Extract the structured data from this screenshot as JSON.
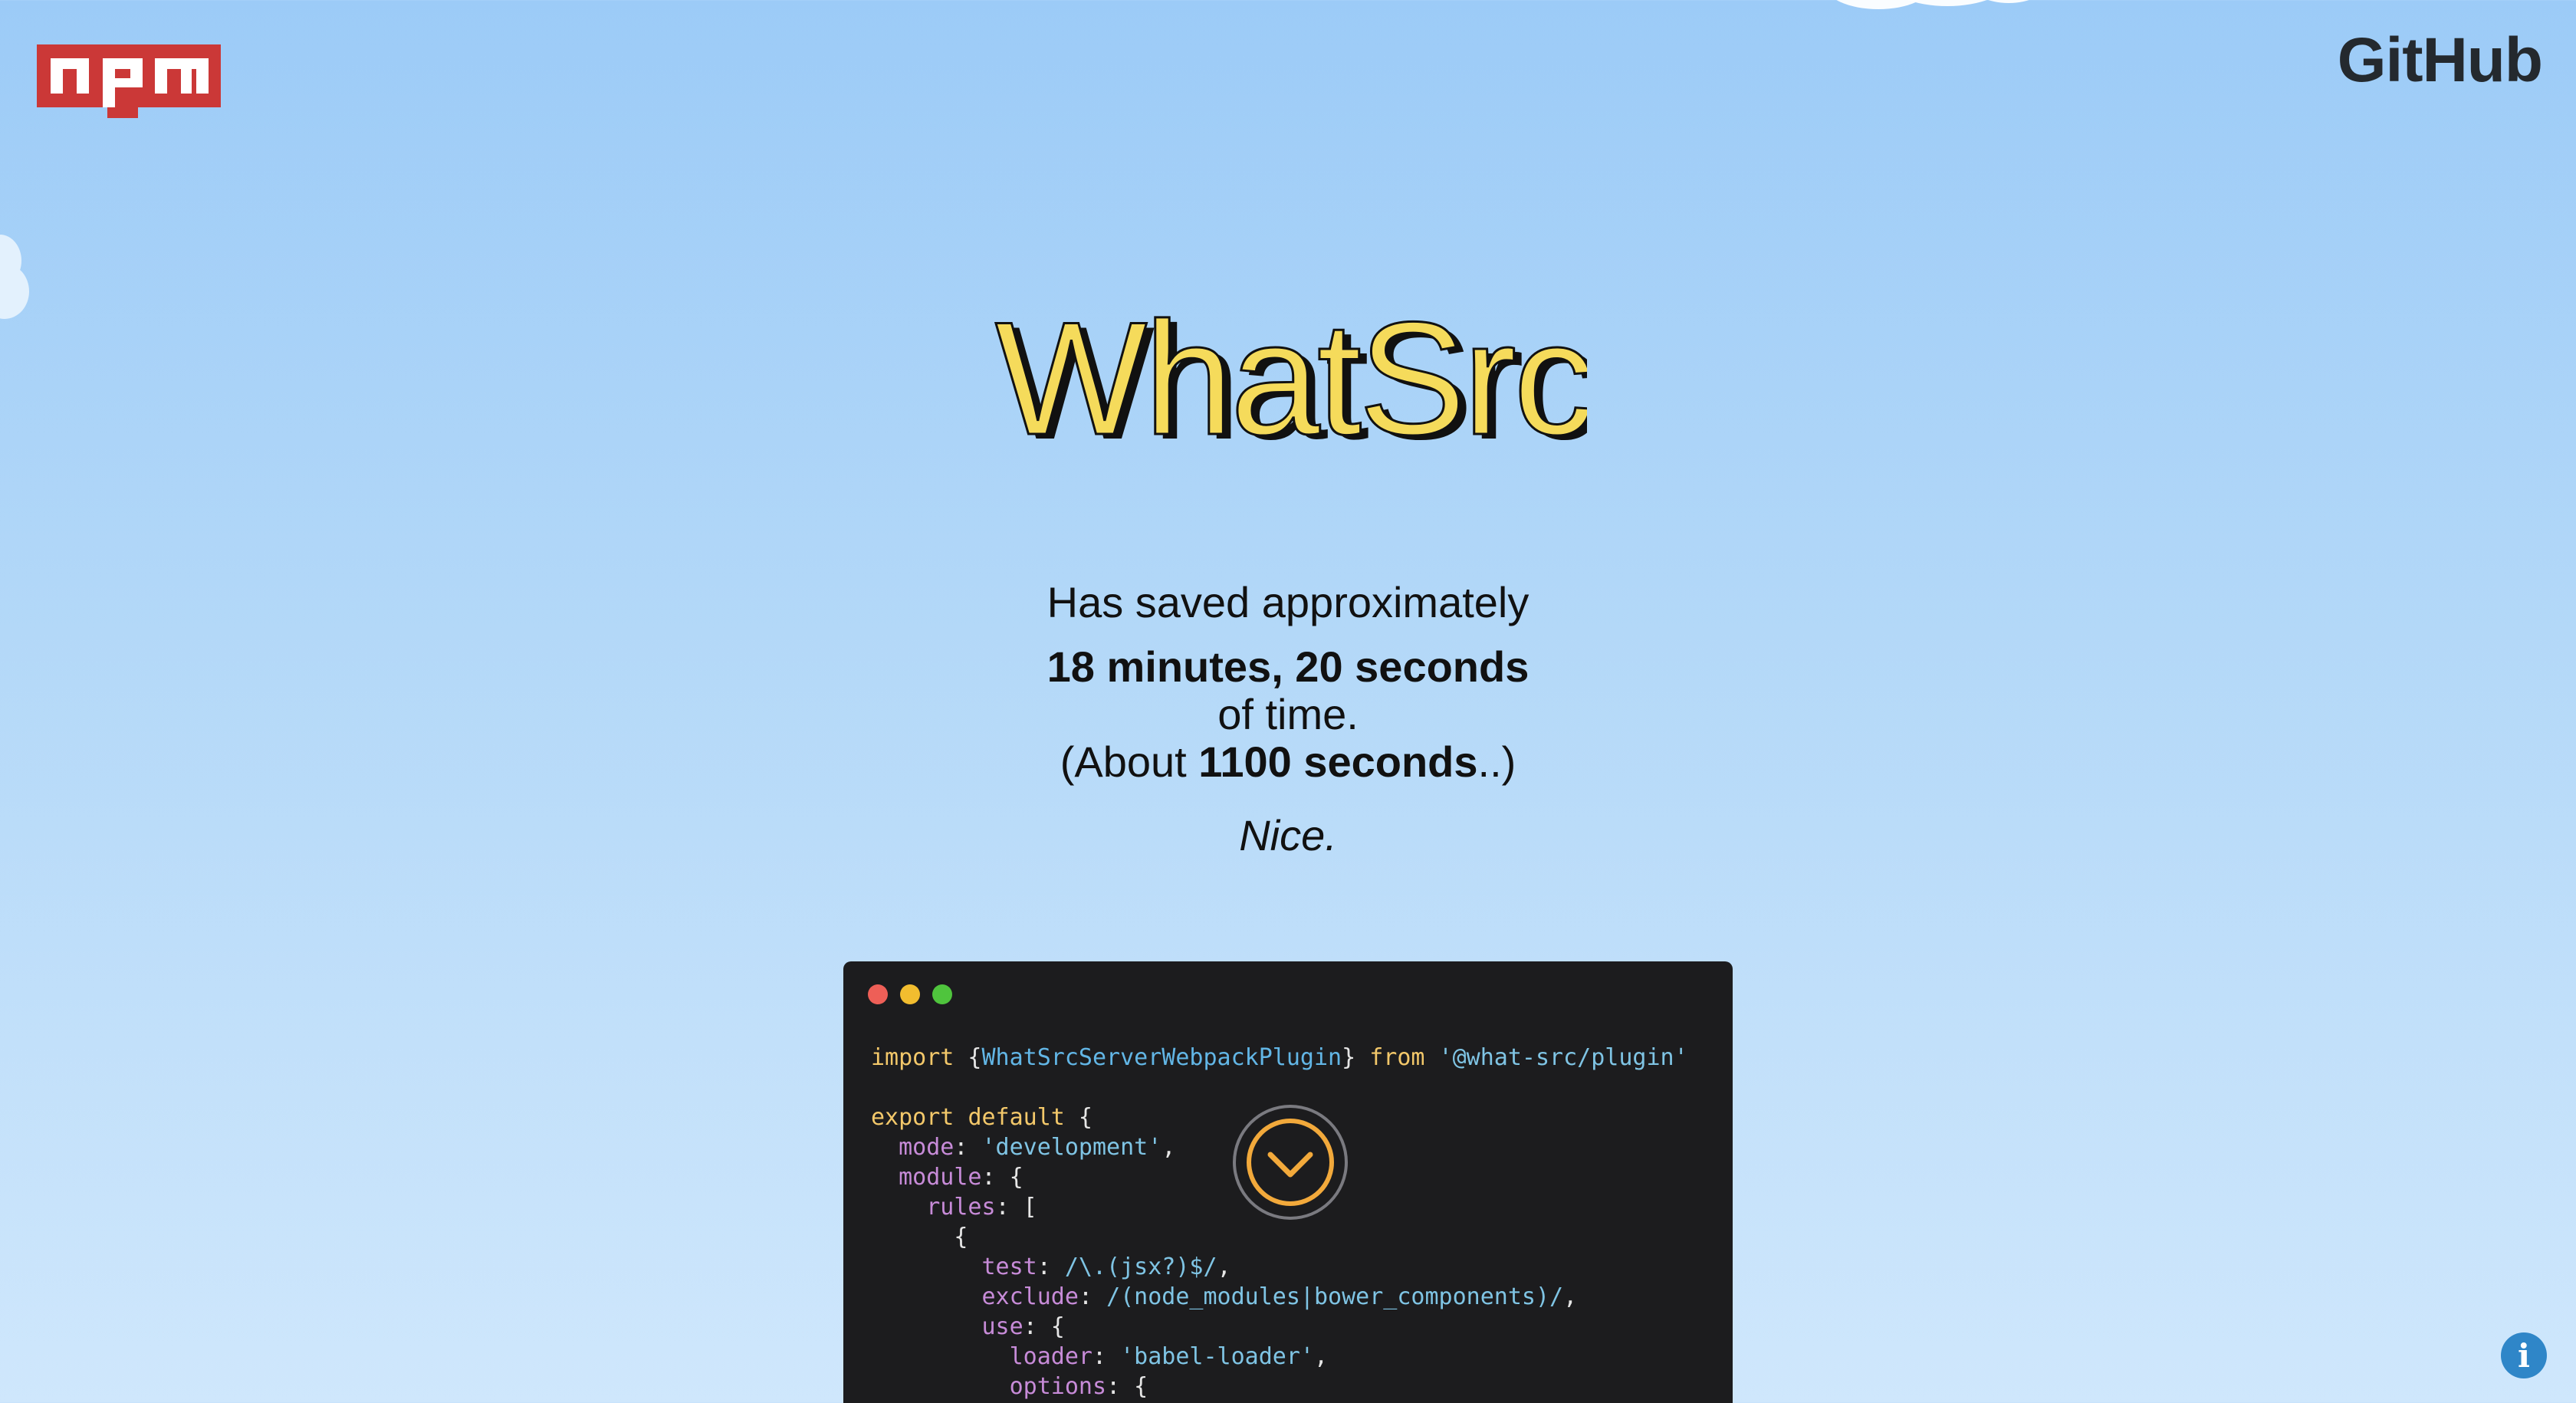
{
  "header": {
    "npm_logo_text": "npm",
    "github_label": "GitHub"
  },
  "brand": {
    "name": "WhatSrc",
    "fill_color": "#f5db5b",
    "outline_color": "#111111"
  },
  "stats": {
    "intro": "Has saved approximately",
    "duration": "18 minutes, 20 seconds",
    "suffix": "of time.",
    "about_prefix": "(About ",
    "about_value": "1100 seconds",
    "about_suffix": "..)",
    "remark": "Nice."
  },
  "code_window": {
    "line1": {
      "import": "import",
      "open_brace": " {",
      "class_name": "WhatSrcServerWebpackPlugin",
      "close_brace": "} ",
      "from": "from",
      "module": " '@what-src/plugin'"
    },
    "lines": {
      "export": "export",
      "default": "default",
      "mode_key": "mode",
      "mode_val": "'development'",
      "module_key": "module",
      "rules_key": "rules",
      "test_key": "test",
      "test_val": "/\\.(jsx?)$/",
      "exclude_key": "exclude",
      "exclude_val": "/(node_modules|bower_components)/",
      "use_key": "use",
      "loader_key": "loader",
      "loader_val": "'babel-loader'",
      "options_key": "options"
    }
  },
  "controls": {
    "scroll_down_icon": "chevron-down-icon",
    "info_icon": "info-icon",
    "info_glyph": "i"
  },
  "colors": {
    "sky_top": "#9ccbf7",
    "sky_bottom": "#cfe7fc",
    "npm_red": "#cb3837",
    "scroll_accent": "#f2a93b",
    "info_blue": "#2f86c8"
  }
}
